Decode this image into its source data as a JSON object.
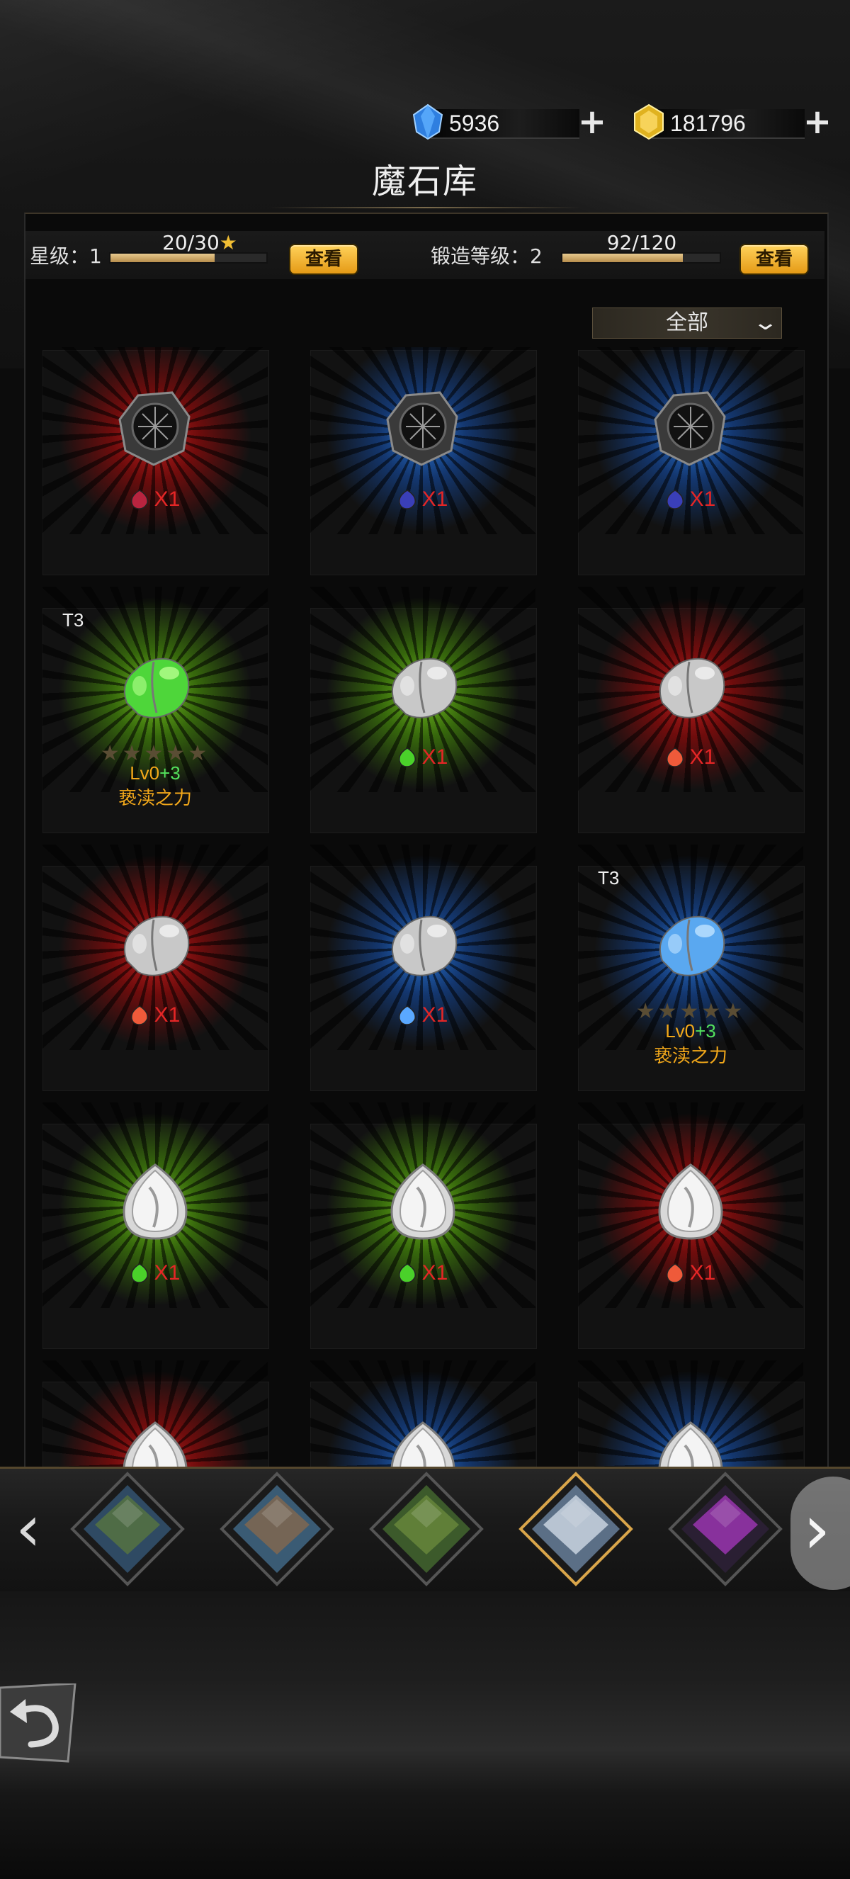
{
  "currencies": [
    {
      "name": "diamond",
      "icon": "blue-crystal-icon",
      "value": "5936"
    },
    {
      "name": "gold",
      "icon": "gold-gem-icon",
      "value": "181796"
    }
  ],
  "title": "魔石库",
  "stats": {
    "star": {
      "label": "星级：1",
      "progress": "20/30",
      "fraction": 0.667,
      "button": "查看"
    },
    "forge": {
      "label": "锻造等级：2",
      "progress": "92/120",
      "fraction": 0.767,
      "button": "查看"
    }
  },
  "filter": {
    "selected": "全部"
  },
  "items": [
    {
      "glow": "red",
      "stone": "dark-orb",
      "qty": "X1",
      "mini": "red"
    },
    {
      "glow": "blue",
      "stone": "dark-orb",
      "qty": "X1",
      "mini": "blue"
    },
    {
      "glow": "blue",
      "stone": "dark-orb",
      "qty": "X1",
      "mini": "blue"
    },
    {
      "glow": "green",
      "stone": "beetle-green",
      "tier": "T3",
      "stars": 5,
      "lv": "Lv0",
      "lv_plus": "+3",
      "name": "亵渎之力"
    },
    {
      "glow": "green",
      "stone": "beetle-silver",
      "qty": "X1",
      "mini": "green"
    },
    {
      "glow": "red",
      "stone": "beetle-silver",
      "qty": "X1",
      "mini": "orange"
    },
    {
      "glow": "red",
      "stone": "beetle-silver",
      "qty": "X1",
      "mini": "orange"
    },
    {
      "glow": "blue",
      "stone": "beetle-silver",
      "qty": "X1",
      "mini": "lightblue"
    },
    {
      "glow": "blue",
      "stone": "beetle-blue",
      "tier": "T3",
      "stars": 5,
      "lv": "Lv0",
      "lv_plus": "+3",
      "name": "亵渎之力"
    },
    {
      "glow": "green",
      "stone": "drop-silver",
      "qty": "X1",
      "mini": "green"
    },
    {
      "glow": "green",
      "stone": "drop-silver",
      "qty": "X1",
      "mini": "green"
    },
    {
      "glow": "red",
      "stone": "drop-silver",
      "qty": "X1",
      "mini": "orange"
    },
    {
      "glow": "red",
      "stone": "drop-silver"
    },
    {
      "glow": "blue",
      "stone": "drop-silver"
    },
    {
      "glow": "blue",
      "stone": "drop-silver"
    }
  ],
  "maps": [
    {
      "name": "dark-forest-map",
      "color": "#2f4a63",
      "accent": "#5c7a3a"
    },
    {
      "name": "snow-village-map",
      "color": "#3a5b74",
      "accent": "#8e6a48"
    },
    {
      "name": "green-hills-map",
      "color": "#3c5a2b",
      "accent": "#6f8f3e"
    },
    {
      "name": "ice-mountain-map",
      "color": "#5b6f86",
      "accent": "#dfe8f2",
      "selected": true
    },
    {
      "name": "shadow-realm-map",
      "color": "#2a1f33",
      "accent": "#b139c9"
    }
  ],
  "colors": {
    "red": "#c81e1e",
    "blue": "#2878dc",
    "green": "#78c81e",
    "qty": "#e52626",
    "level_name": "#f2a81a",
    "button": "#f2a81a"
  }
}
